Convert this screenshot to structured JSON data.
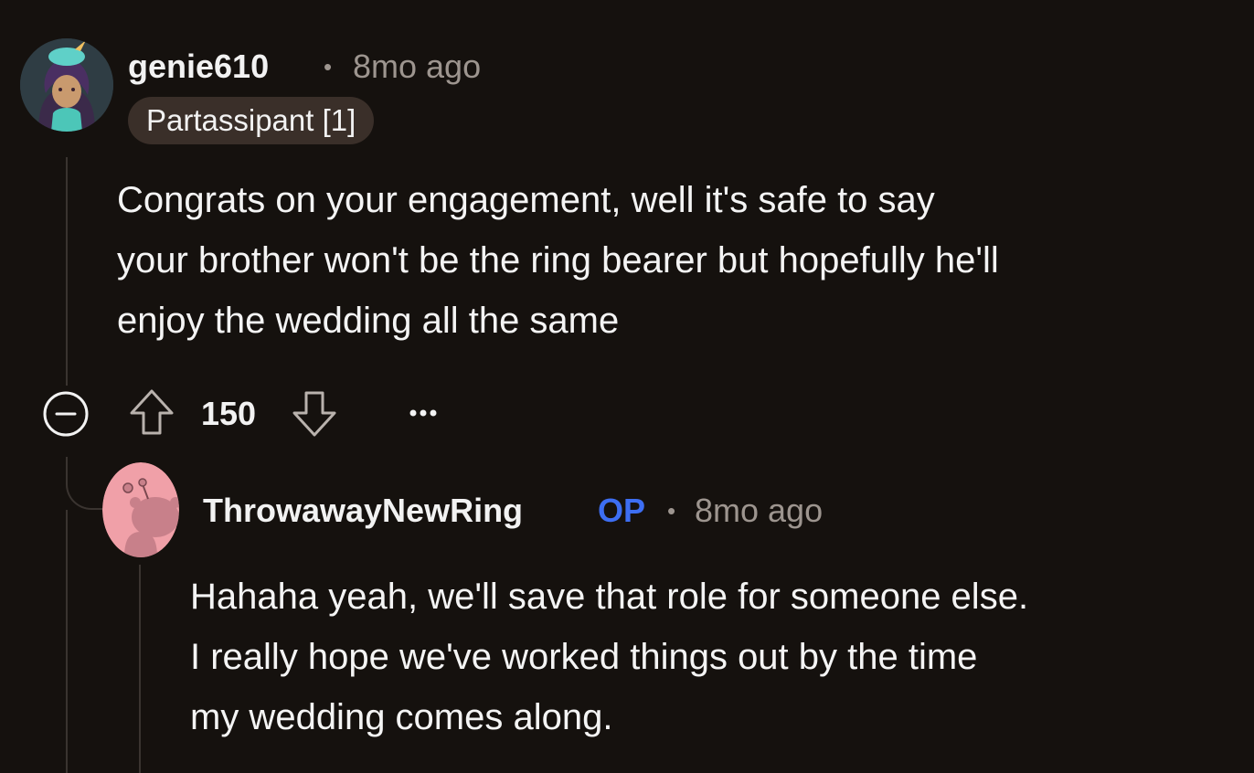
{
  "comment": {
    "username": "genie610",
    "separator": "•",
    "time": "8mo ago",
    "flair": "Partassipant [1]",
    "body_lines": [
      "Congrats on your engagement, well it's safe to say",
      "your brother won't be the ring bearer but hopefully he'll",
      "enjoy the wedding all the same"
    ],
    "score": "150",
    "more_label": "•••"
  },
  "reply": {
    "username": "ThrowawayNewRing",
    "op_tag": "OP",
    "separator": "•",
    "time": "8mo ago",
    "body_lines": [
      "Hahaha yeah, we'll save that role for someone else.",
      "I really hope we've worked things out by the time",
      "my wedding comes along."
    ]
  },
  "colors": {
    "background": "#15110e",
    "muted_text": "#9d958f",
    "op_blue": "#3d6ef2",
    "flair_bg": "#3a2f29",
    "reply_avatar_bg": "#f0a0a8"
  }
}
